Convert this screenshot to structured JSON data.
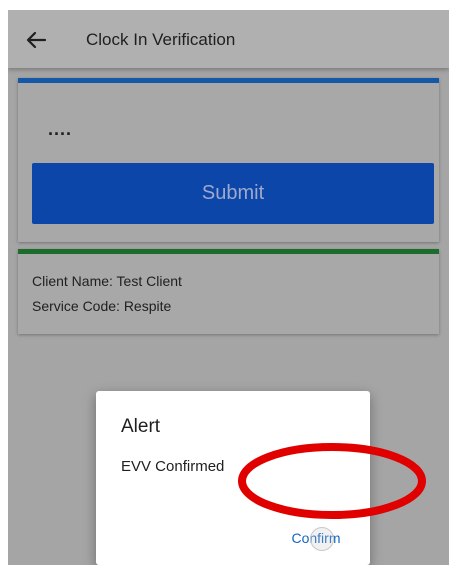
{
  "app_bar": {
    "title": "Clock In Verification",
    "back_icon": "arrow-left-icon"
  },
  "pin_card": {
    "accent_color": "#1558a8",
    "pin_value": "....",
    "submit_label": "Submit",
    "submit_color": "#0c46a8"
  },
  "client_card": {
    "accent_color": "#1c6d2b",
    "client_name_line": "Client Name: Test Client",
    "service_code_line": "Service Code: Respite"
  },
  "dialog": {
    "title": "Alert",
    "message": "EVV Confirmed",
    "confirm_label": "Confirm",
    "confirm_color": "#1565c0"
  },
  "annotation": {
    "shape": "ellipse",
    "color": "#e00000"
  }
}
